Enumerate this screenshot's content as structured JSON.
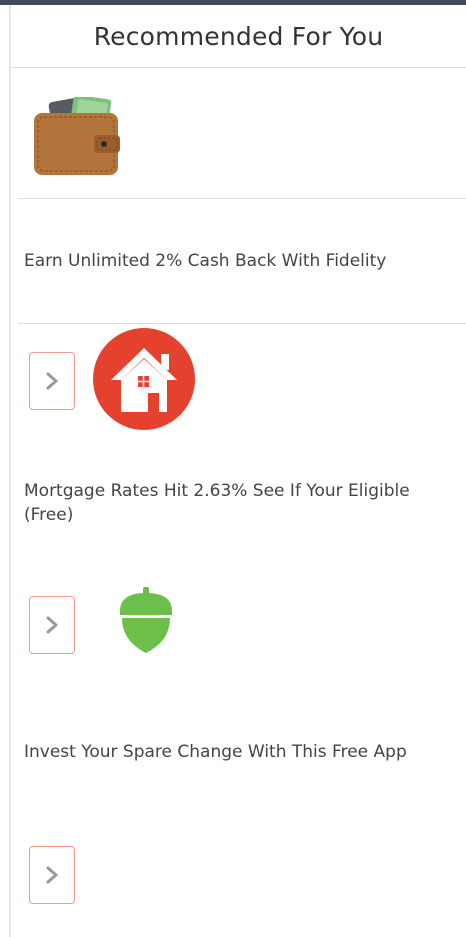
{
  "widget": {
    "title": "Recommended For You"
  },
  "items": [
    {
      "text": "Earn Unlimited 2% Cash Back With Fidelity",
      "icon": "wallet-icon"
    },
    {
      "text": "Mortgage Rates Hit 2.63% See If Your Eligible (Free)",
      "icon": "house-icon"
    },
    {
      "text": "Invest Your Spare Change With This Free App",
      "icon": "acorn-icon"
    }
  ],
  "colors": {
    "header_border": "#3d4d5a",
    "button_border": "#f09a8c",
    "house_red": "#e4412f",
    "acorn_green": "#6cc04a"
  }
}
